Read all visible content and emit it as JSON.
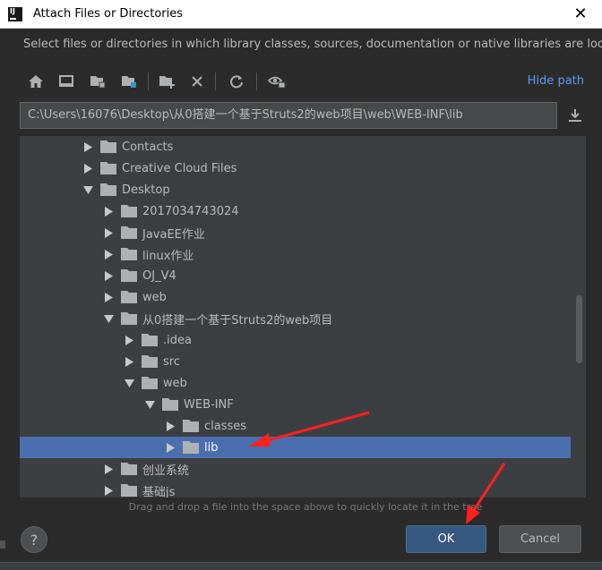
{
  "window": {
    "title": "Attach Files or Directories"
  },
  "description": "Select files or directories in which library classes, sources, documentation or native libraries are located",
  "toolbar": {
    "buttons": [
      "home-icon",
      "desktop-icon",
      "project-folder-icon",
      "module-folder-icon",
      "new-folder-icon",
      "delete-icon",
      "refresh-icon",
      "show-hidden-icon"
    ],
    "hide_path_label": "Hide path"
  },
  "path": {
    "value": "C:\\Users\\16076\\Desktop\\从0搭建一个基于Struts2的web项目\\web\\WEB-INF\\lib"
  },
  "tree": {
    "items": [
      {
        "label": "Contacts",
        "depth": 3,
        "expanded": false,
        "selected": false
      },
      {
        "label": "Creative Cloud Files",
        "depth": 3,
        "expanded": false,
        "selected": false
      },
      {
        "label": "Desktop",
        "depth": 3,
        "expanded": true,
        "selected": false
      },
      {
        "label": "2017034743024",
        "depth": 4,
        "expanded": false,
        "selected": false
      },
      {
        "label": "JavaEE作业",
        "depth": 4,
        "expanded": false,
        "selected": false
      },
      {
        "label": "linux作业",
        "depth": 4,
        "expanded": false,
        "selected": false
      },
      {
        "label": "OJ_V4",
        "depth": 4,
        "expanded": false,
        "selected": false
      },
      {
        "label": "web",
        "depth": 4,
        "expanded": false,
        "selected": false
      },
      {
        "label": "从0搭建一个基于Struts2的web项目",
        "depth": 4,
        "expanded": true,
        "selected": false
      },
      {
        "label": ".idea",
        "depth": 5,
        "expanded": false,
        "selected": false
      },
      {
        "label": "src",
        "depth": 5,
        "expanded": false,
        "selected": false
      },
      {
        "label": "web",
        "depth": 5,
        "expanded": true,
        "selected": false
      },
      {
        "label": "WEB-INF",
        "depth": 6,
        "expanded": true,
        "selected": false
      },
      {
        "label": "classes",
        "depth": 7,
        "expanded": false,
        "selected": false
      },
      {
        "label": "lib",
        "depth": 7,
        "expanded": false,
        "selected": true
      },
      {
        "label": "创业系统",
        "depth": 4,
        "expanded": false,
        "selected": false
      },
      {
        "label": "基础js",
        "depth": 4,
        "expanded": false,
        "selected": false
      }
    ]
  },
  "hint": "Drag and drop a file into the space above to quickly locate it in the tree",
  "footer": {
    "help_label": "?",
    "ok_label": "OK",
    "cancel_label": "Cancel"
  },
  "colors": {
    "background": "#2b2b2b",
    "tree_background": "#3c3f41",
    "selection": "#4b6eaf",
    "link": "#589df6",
    "annotation_arrow": "#ff2020"
  }
}
